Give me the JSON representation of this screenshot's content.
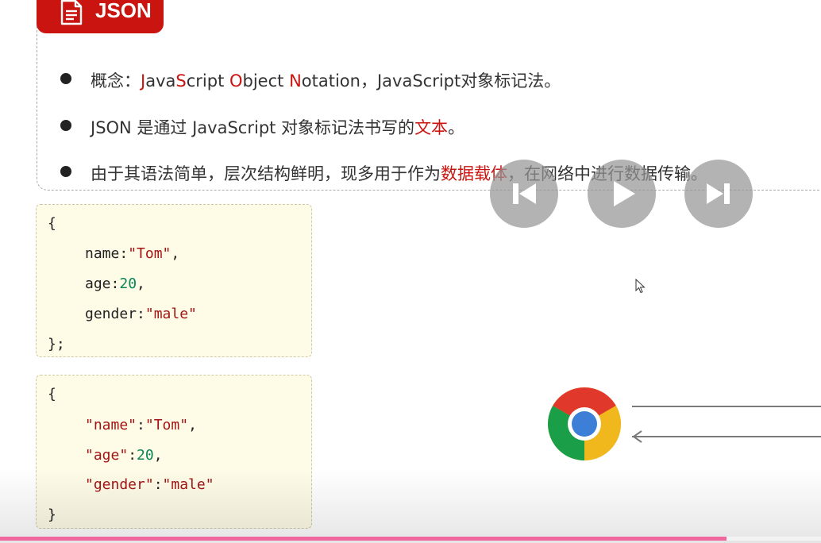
{
  "title": {
    "icon": "document-icon",
    "text": "JSON",
    "color": "#c9140f"
  },
  "bullets": [
    {
      "prefix": "概念：",
      "j": "J",
      "ava": "ava",
      "s": "S",
      "cript": "cript ",
      "o": "O",
      "bject": "bject ",
      "n": "N",
      "otation": "otation，JavaScript对象标记法。"
    },
    {
      "before": "JSON 是通过 JavaScript 对象标记法书写的",
      "highlight": "文本",
      "after": "。"
    },
    {
      "before": "由于其语法简单，层次结构鲜明，现多用于作为",
      "highlight": "数据载体",
      "after": "，在网络中进行数据传输。"
    }
  ],
  "code_js": {
    "open": "{",
    "name_key": "name",
    "name_sep": ":",
    "name_val": "\"Tom\"",
    "name_end": ",",
    "age_key": "age",
    "age_sep": ":",
    "age_val": "20",
    "age_end": ",",
    "gender_key": "gender",
    "gender_sep": ":",
    "gender_val": "\"male\"",
    "close": "};"
  },
  "code_json": {
    "open": "{",
    "name_key": "\"name\"",
    "name_sep": ":",
    "name_val": "\"Tom\"",
    "name_end": ",",
    "age_key": "\"age\"",
    "age_sep": ":",
    "age_val": "20",
    "age_end": ",",
    "gender_key": "\"gender\"",
    "gender_sep": ":",
    "gender_val": "\"male\"",
    "close": "}"
  },
  "player": {
    "buttons": [
      "skip-back-icon",
      "play-icon",
      "skip-forward-icon"
    ],
    "progress": 0.885,
    "progress_color": "#f0679e"
  },
  "illustration": {
    "icon": "chrome-icon",
    "arrows": [
      "arrow-right-icon",
      "arrow-left-icon"
    ]
  }
}
